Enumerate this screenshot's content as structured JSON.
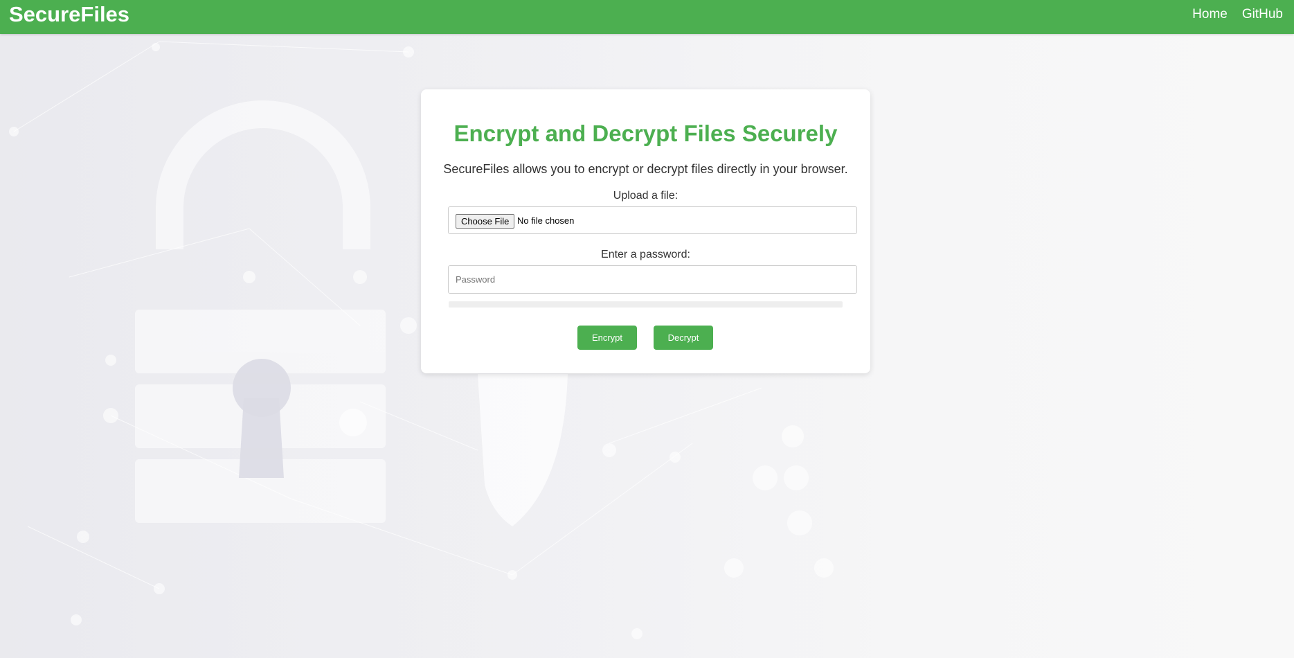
{
  "navbar": {
    "brand": "SecureFiles",
    "links": [
      {
        "label": "Home"
      },
      {
        "label": "GitHub"
      }
    ]
  },
  "main": {
    "title": "Encrypt and Decrypt Files Securely",
    "description": "SecureFiles allows you to encrypt or decrypt files directly in your browser.",
    "upload": {
      "label": "Upload a file:",
      "button_label": "Choose File",
      "status": "No file chosen"
    },
    "password": {
      "label": "Enter a password:",
      "placeholder": "Password",
      "value": ""
    },
    "progress": {
      "percent": 0
    },
    "buttons": {
      "encrypt": "Encrypt",
      "decrypt": "Decrypt"
    }
  },
  "colors": {
    "accent": "#4caf50",
    "background": "#f2f2f5",
    "card": "#ffffff",
    "text": "#333333"
  },
  "background_image": {
    "icon": "padlock-network-icon"
  }
}
